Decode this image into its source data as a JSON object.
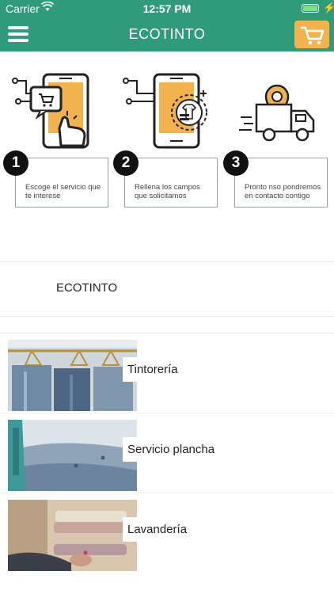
{
  "status": {
    "carrier": "Carrier",
    "time": "12:57 PM"
  },
  "nav": {
    "title": "ECOTINTO"
  },
  "steps": [
    {
      "number": "1",
      "text": "Escoge el servicio que te interese"
    },
    {
      "number": "2",
      "text": "Rellena los campos que solicitamos"
    },
    {
      "number": "3",
      "text": "Pronto nso pondremos en contacto contigo"
    }
  ],
  "section": {
    "title": "ECOTINTO"
  },
  "services": [
    {
      "label": "Tintorería"
    },
    {
      "label": "Servicio plancha"
    },
    {
      "label": "Lavandería"
    }
  ],
  "colors": {
    "brand": "#2f9b78",
    "accent": "#f2b24d"
  }
}
